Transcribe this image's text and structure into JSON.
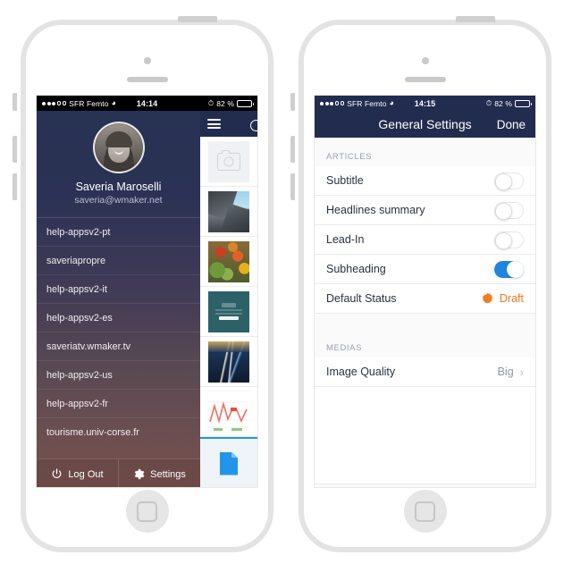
{
  "left_phone": {
    "status_bar": {
      "signal_filled": 3,
      "signal_empty": 2,
      "carrier": "SFR Femto",
      "wifi_icon": "wifi-icon",
      "time": "14:14",
      "alarm_icon": "alarm-clock-icon",
      "battery_percent": "82 %",
      "battery_icon": "battery-icon"
    },
    "profile": {
      "avatar_icon": "user-avatar",
      "name": "Saveria Maroselli",
      "email": "saveria@wmaker.net"
    },
    "sites": [
      {
        "label": "help-appsv2-pt"
      },
      {
        "label": "saveriapropre"
      },
      {
        "label": "help-appsv2-it"
      },
      {
        "label": "help-appsv2-es"
      },
      {
        "label": "saveriatv.wmaker.tv"
      },
      {
        "label": "help-appsv2-us"
      },
      {
        "label": "help-appsv2-fr"
      },
      {
        "label": "tourisme.univ-corse.fr"
      }
    ],
    "toolbar": {
      "logout_label": "Log Out",
      "logout_icon": "power-icon",
      "settings_label": "Settings",
      "settings_icon": "gear-icon"
    },
    "navbar": {
      "menu_icon": "hamburger-menu-icon",
      "partial_icon": "circle-icon"
    },
    "thumbnails": [
      {
        "name": "camera-placeholder-thumbnail",
        "kind": "camera"
      },
      {
        "name": "buildings-photo-thumbnail",
        "kind": "bldg"
      },
      {
        "name": "vegetables-photo-thumbnail",
        "kind": "veg"
      },
      {
        "name": "login-screen-thumbnail",
        "kind": "login"
      },
      {
        "name": "light-trails-photo-thumbnail",
        "kind": "trails"
      },
      {
        "name": "line-chart-thumbnail",
        "kind": "chart"
      },
      {
        "name": "document-icon-thumbnail",
        "kind": "doc"
      }
    ]
  },
  "right_phone": {
    "status_bar": {
      "signal_filled": 3,
      "signal_empty": 2,
      "carrier": "SFR Femto",
      "wifi_icon": "wifi-icon",
      "time": "14:15",
      "alarm_icon": "alarm-clock-icon",
      "battery_percent": "82 %",
      "battery_icon": "battery-icon"
    },
    "navbar": {
      "title": "General Settings",
      "done_label": "Done"
    },
    "sections": [
      {
        "header": "ARTICLES",
        "rows": [
          {
            "label": "Subtitle",
            "control": "toggle",
            "value": "off"
          },
          {
            "label": "Headlines summary",
            "control": "toggle",
            "value": "off"
          },
          {
            "label": "Lead-In",
            "control": "toggle",
            "value": "off"
          },
          {
            "label": "Subheading",
            "control": "toggle",
            "value": "on"
          },
          {
            "label": "Default Status",
            "control": "badge",
            "value": "Draft",
            "badge_icon": "orange-burst-icon"
          }
        ]
      },
      {
        "header": "MEDIAS",
        "rows": [
          {
            "label": "Image Quality",
            "control": "disclosure",
            "value": "Big",
            "chevron": "chevron-right-icon"
          }
        ]
      }
    ]
  },
  "colors": {
    "navy": "#222c4e",
    "toggle_on": "#1f86e0",
    "orange": "#ee7a1e",
    "doc_blue": "#2196e8",
    "frame": "#e3e3e3"
  }
}
